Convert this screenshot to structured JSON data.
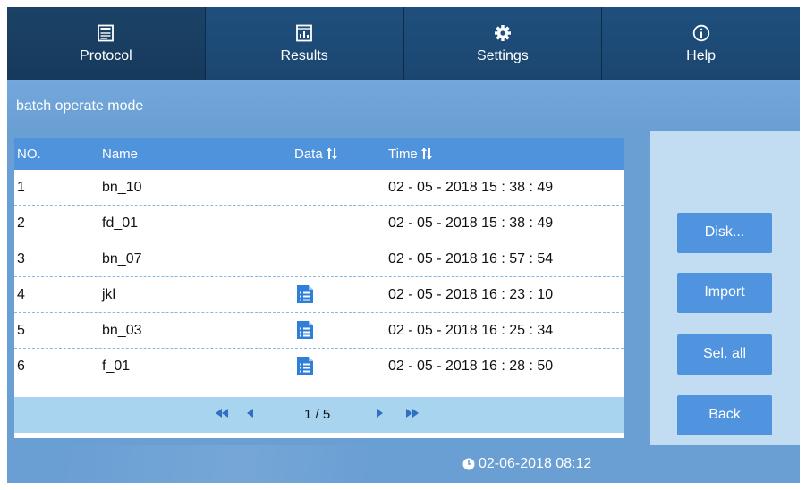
{
  "nav": {
    "tabs": [
      {
        "label": "Protocol",
        "icon": "protocol-icon",
        "active": true
      },
      {
        "label": "Results",
        "icon": "results-chart-icon",
        "active": false
      },
      {
        "label": "Settings",
        "icon": "gear-icon",
        "active": false
      },
      {
        "label": "Help",
        "icon": "info-icon",
        "active": false
      }
    ]
  },
  "header": {
    "title": "batch operate mode"
  },
  "table": {
    "columns": {
      "no": "NO.",
      "name": "Name",
      "data": "Data",
      "time": "Time"
    },
    "rows": [
      {
        "no": "1",
        "name": "bn_10",
        "has_data": false,
        "time": "02 - 05 - 2018 15 : 38 : 49"
      },
      {
        "no": "2",
        "name": "fd_01",
        "has_data": false,
        "time": "02 - 05 - 2018 15 : 38 : 49"
      },
      {
        "no": "3",
        "name": "bn_07",
        "has_data": false,
        "time": "02 - 05 - 2018 16 : 57 : 54"
      },
      {
        "no": "4",
        "name": "jkl",
        "has_data": true,
        "time": "02 - 05 - 2018 16 : 23 : 10"
      },
      {
        "no": "5",
        "name": "bn_03",
        "has_data": true,
        "time": "02 - 05 - 2018 16 : 25 : 34"
      },
      {
        "no": "6",
        "name": "f_01",
        "has_data": true,
        "time": "02 - 05 - 2018 16 : 28 : 50"
      }
    ],
    "pagination": {
      "page": "1 / 5"
    }
  },
  "side_buttons": {
    "disk": "Disk...",
    "import": "Import",
    "select_all": "Sel. all",
    "back": "Back"
  },
  "footer": {
    "datetime": "02-06-2018 08:12"
  },
  "colors": {
    "nav_bg": "#1f4f7d",
    "accent_blue": "#5094e0",
    "panel_bg": "#6a9fd4",
    "table_header": "#4e93dc",
    "pager_bg": "#a9d4f0"
  }
}
